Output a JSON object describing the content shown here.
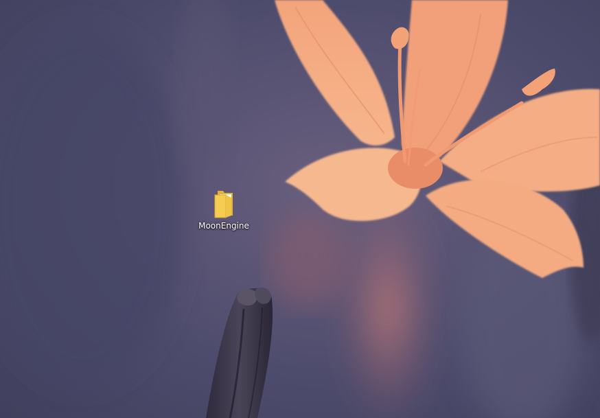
{
  "desktop": {
    "icons": [
      {
        "label": "MoonEngine",
        "type": "folder",
        "icon": "folder-icon"
      }
    ]
  },
  "colors": {
    "background": "#4b4a6b",
    "petal": "#f2a97f",
    "folder": "#f3c84a"
  }
}
